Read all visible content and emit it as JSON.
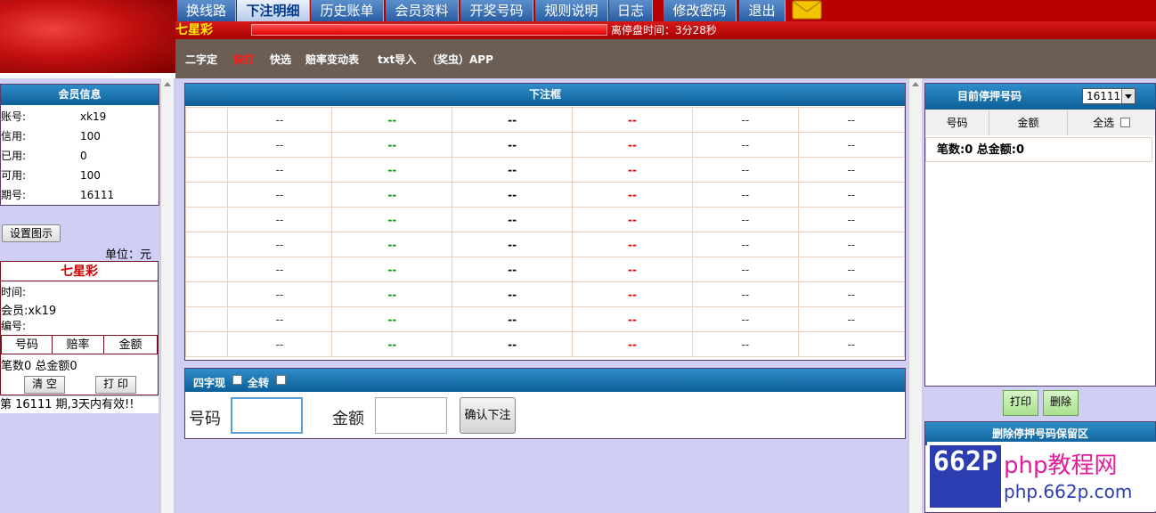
{
  "nav": {
    "tabs": [
      {
        "label": "换线路",
        "active": false
      },
      {
        "label": "下注明细",
        "active": true
      },
      {
        "label": "历史账单",
        "active": false
      },
      {
        "label": "会员资料",
        "active": false
      },
      {
        "label": "开奖号码",
        "active": false
      },
      {
        "label": "规则说明",
        "active": false
      },
      {
        "label": "日志",
        "active": false
      },
      {
        "label": "修改密码",
        "active": false
      },
      {
        "label": "退出",
        "active": false
      }
    ],
    "mail_icon": "mail-envelope-icon"
  },
  "status": {
    "game_title": "七星彩",
    "closing_time": "离停盘时间：3分28秒"
  },
  "subnav": {
    "links": [
      {
        "label": "二字定",
        "active": false
      },
      {
        "label": "快打",
        "active": true
      },
      {
        "label": "快选",
        "active": false
      },
      {
        "label": "赔率变动表",
        "active": false
      },
      {
        "label": "txt导入",
        "active": false
      },
      {
        "label": "（奖虫）APP",
        "active": false
      }
    ]
  },
  "member": {
    "title": "会员信息",
    "rows": [
      {
        "label": "账号:",
        "value": "xk19"
      },
      {
        "label": "信用:",
        "value": "100"
      },
      {
        "label": "已用:",
        "value": "0"
      },
      {
        "label": "可用:",
        "value": "100"
      },
      {
        "label": "期号:",
        "value": "16111"
      }
    ]
  },
  "settings_button": "设置图示",
  "unit_label": "单位：元",
  "receipt": {
    "title": "七星彩",
    "time_label": "时间:",
    "member_label": "会员:xk19",
    "code_label": "编号:",
    "headers": [
      "号码",
      "赔率",
      "金额"
    ],
    "summary": "笔数0 总金额0",
    "clear_button": "清 空",
    "print_button": "打 印",
    "validity_note": "第 16111 期,3天内有效!!"
  },
  "bet_box": {
    "title": "下注框",
    "placeholder": "--",
    "row_count": 10
  },
  "input_panel": {
    "four_digit_label": "四字现",
    "all_turn_label": "全转",
    "number_label": "号码",
    "amount_label": "金额",
    "confirm_button": "确认下注"
  },
  "hold": {
    "title": "目前停押号码",
    "period_value": "16111",
    "col_number": "号码",
    "col_amount": "金额",
    "col_select_all": "全选",
    "summary": "笔数:0 总金额:0",
    "print_button": "打印",
    "delete_button": "删除"
  },
  "delete_area": {
    "title": "删除停押号码保留区"
  },
  "watermark": {
    "logo_text": "662P",
    "site_name": "php教程网",
    "url": "php.662p.com"
  },
  "colors": {
    "header_red": "#b80000",
    "tab_blue": "#2a5ea3",
    "panel_blue": "#0d5f97",
    "background": "#cfcff5"
  }
}
